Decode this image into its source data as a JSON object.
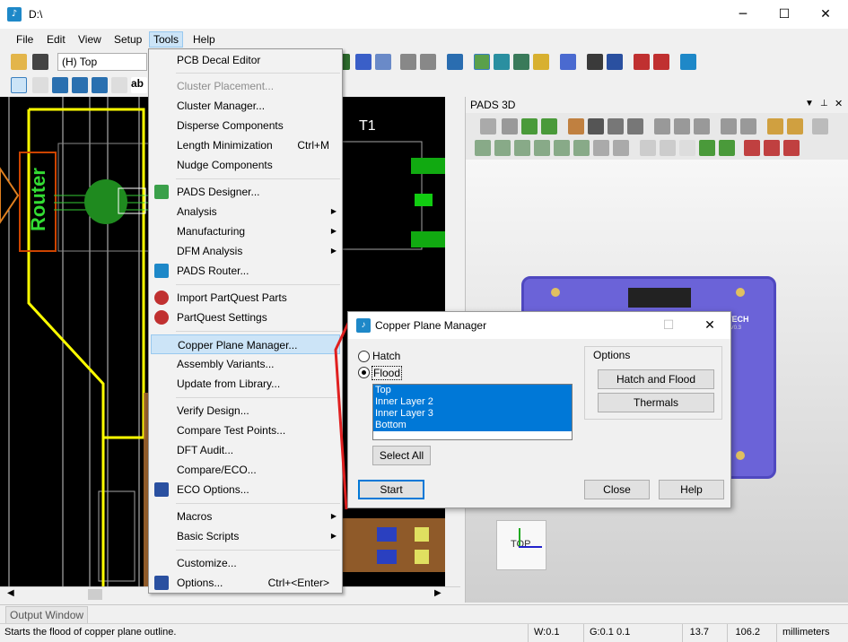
{
  "window": {
    "title": "D:\\",
    "minimize": "─",
    "maximize": "☐",
    "close": "✕"
  },
  "menubar": {
    "file": "File",
    "edit": "Edit",
    "view": "View",
    "setup": "Setup",
    "tools": "Tools",
    "help": "Help"
  },
  "toolbar": {
    "layer_combo": "(H) Top"
  },
  "panel3d": {
    "title": "PADS 3D",
    "axis_label": "TOP",
    "board_text_1": "ON TECH",
    "board_text_2": "PMS V0.3"
  },
  "canvas": {
    "router_label": "Router",
    "t1_label": "T1"
  },
  "tools_menu": {
    "items": [
      {
        "label": "PCB Decal Editor",
        "shortcut": "",
        "disabled": false
      },
      {
        "label": "Cluster Placement...",
        "shortcut": "",
        "disabled": true
      },
      {
        "label": "Cluster Manager...",
        "shortcut": "",
        "disabled": false
      },
      {
        "label": "Disperse Components",
        "shortcut": "",
        "disabled": false
      },
      {
        "label": "Length Minimization",
        "shortcut": "Ctrl+M",
        "disabled": false
      },
      {
        "label": "Nudge Components",
        "shortcut": "",
        "disabled": false
      },
      {
        "label": "PADS Designer...",
        "shortcut": "",
        "disabled": false
      },
      {
        "label": "Analysis",
        "shortcut": "",
        "disabled": false
      },
      {
        "label": "Manufacturing",
        "shortcut": "",
        "disabled": false
      },
      {
        "label": "DFM Analysis",
        "shortcut": "",
        "disabled": false
      },
      {
        "label": "PADS Router...",
        "shortcut": "",
        "disabled": false
      },
      {
        "label": "Import PartQuest Parts",
        "shortcut": "",
        "disabled": false
      },
      {
        "label": "PartQuest Settings",
        "shortcut": "",
        "disabled": false
      },
      {
        "label": "Copper Plane Manager...",
        "shortcut": "",
        "disabled": false
      },
      {
        "label": "Assembly Variants...",
        "shortcut": "",
        "disabled": false
      },
      {
        "label": "Update from Library...",
        "shortcut": "",
        "disabled": false
      },
      {
        "label": "Verify Design...",
        "shortcut": "",
        "disabled": false
      },
      {
        "label": "Compare Test Points...",
        "shortcut": "",
        "disabled": false
      },
      {
        "label": "DFT Audit...",
        "shortcut": "",
        "disabled": false
      },
      {
        "label": "Compare/ECO...",
        "shortcut": "",
        "disabled": false
      },
      {
        "label": "ECO Options...",
        "shortcut": "",
        "disabled": false
      },
      {
        "label": "Macros",
        "shortcut": "",
        "disabled": false
      },
      {
        "label": "Basic Scripts",
        "shortcut": "",
        "disabled": false
      },
      {
        "label": "Customize...",
        "shortcut": "",
        "disabled": false
      },
      {
        "label": "Options...",
        "shortcut": "Ctrl+<Enter>",
        "disabled": false
      }
    ]
  },
  "dialog": {
    "title": "Copper Plane Manager",
    "hatch_label": "Hatch",
    "flood_label": "Flood",
    "selected_mode": "Flood",
    "layers": [
      "Top",
      "Inner Layer 2",
      "Inner Layer 3",
      "Bottom"
    ],
    "select_all": "Select All",
    "options_label": "Options",
    "hatch_and_flood": "Hatch and Flood",
    "thermals": "Thermals",
    "start": "Start",
    "close": "Close",
    "help": "Help"
  },
  "output_window": {
    "tab": "Output Window"
  },
  "statusbar": {
    "message": "Starts the flood of copper plane outline.",
    "w": "W:0.1",
    "g": "G:0.1 0.1",
    "x": "13.7",
    "y": "106.2",
    "units": "millimeters"
  },
  "colors": {
    "accent": "#0078d7",
    "menu_highlight": "#cce4f7",
    "board": "#6b63d8",
    "router_yellow": "#ffff00"
  }
}
